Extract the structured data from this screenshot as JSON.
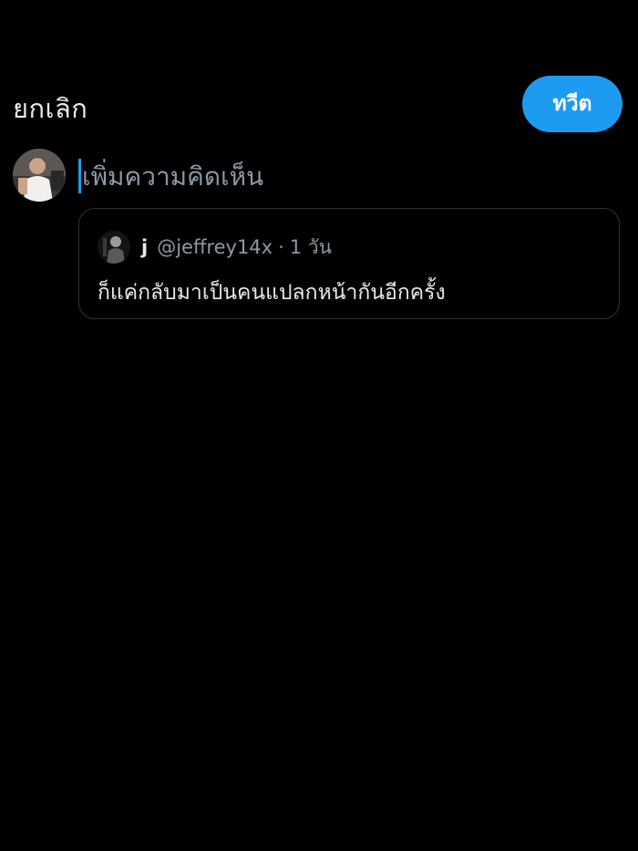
{
  "header": {
    "cancel_label": "ยกเลิก",
    "tweet_label": "ทวีต"
  },
  "composer": {
    "placeholder": "เพิ่มความคิดเห็น"
  },
  "quoted_tweet": {
    "name": "j",
    "handle": "@jeffrey14x",
    "separator": "·",
    "time": "1 วัน",
    "text": "ก็แค่กลับมาเป็นคนแปลกหน้ากันอีกครั้ง"
  },
  "colors": {
    "background": "#000000",
    "accent": "#1d9bf0",
    "text_primary": "#e7e9ea",
    "text_secondary": "#8b98a5",
    "border": "#2f3336"
  }
}
